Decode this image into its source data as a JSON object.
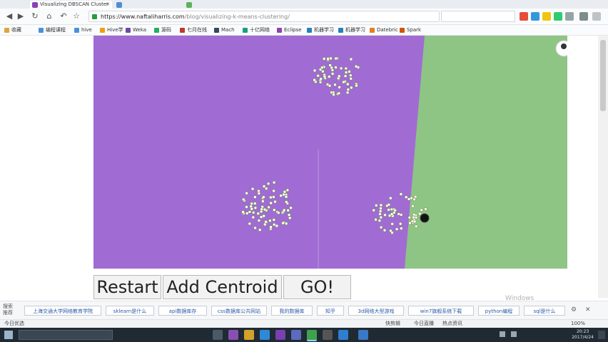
{
  "browser": {
    "tabs": [
      {
        "title": "Visualizing DBSCAN Cluster",
        "active": true,
        "icon": "n-favicon",
        "color": "#8c3fb5"
      },
      {
        "title": "",
        "active": false,
        "icon": "web-icon",
        "color": "#4d8dd6"
      },
      {
        "title": "",
        "active": false,
        "icon": "web-icon",
        "color": "#5bb35b"
      }
    ],
    "url_host": "https://www.naftaliharris.com",
    "url_path": "/blog/visualizing-k-means-clustering/",
    "search_text": "",
    "bookmarks": [
      "收藏",
      "编程课程",
      "hive",
      "Hive学",
      "Weka",
      "源码",
      "七月在线",
      "Mach",
      "十亿网络",
      "Eclipse",
      "机器学习",
      "机器学习",
      "Datebric",
      "Spark"
    ]
  },
  "page": {
    "buttons": {
      "restart": "Restart",
      "add_centroid": "Add Centroid",
      "go": "GO!"
    },
    "colors": {
      "region_purple": "#a16bd4",
      "region_green": "#8ec585",
      "point_fill": "#ffffff",
      "centroid": "#111111"
    },
    "watermark": "Windows"
  },
  "suggestions": {
    "label": "搜索推荐",
    "items": [
      "上海交通大学网络教育学院",
      "sklearn是什么",
      "api数据库存",
      "css数据库公共网站",
      "我的数据库",
      "知乎",
      "3d网络大型游戏",
      "win7旗舰系统下载",
      "python编程",
      "sql是什么"
    ]
  },
  "status": {
    "left": "今日优选",
    "right_items": [
      "快剪辑",
      "今日直播",
      "热点资讯",
      "100%"
    ]
  },
  "taskbar": {
    "time": "20:23",
    "date": "2017/4/24"
  }
}
